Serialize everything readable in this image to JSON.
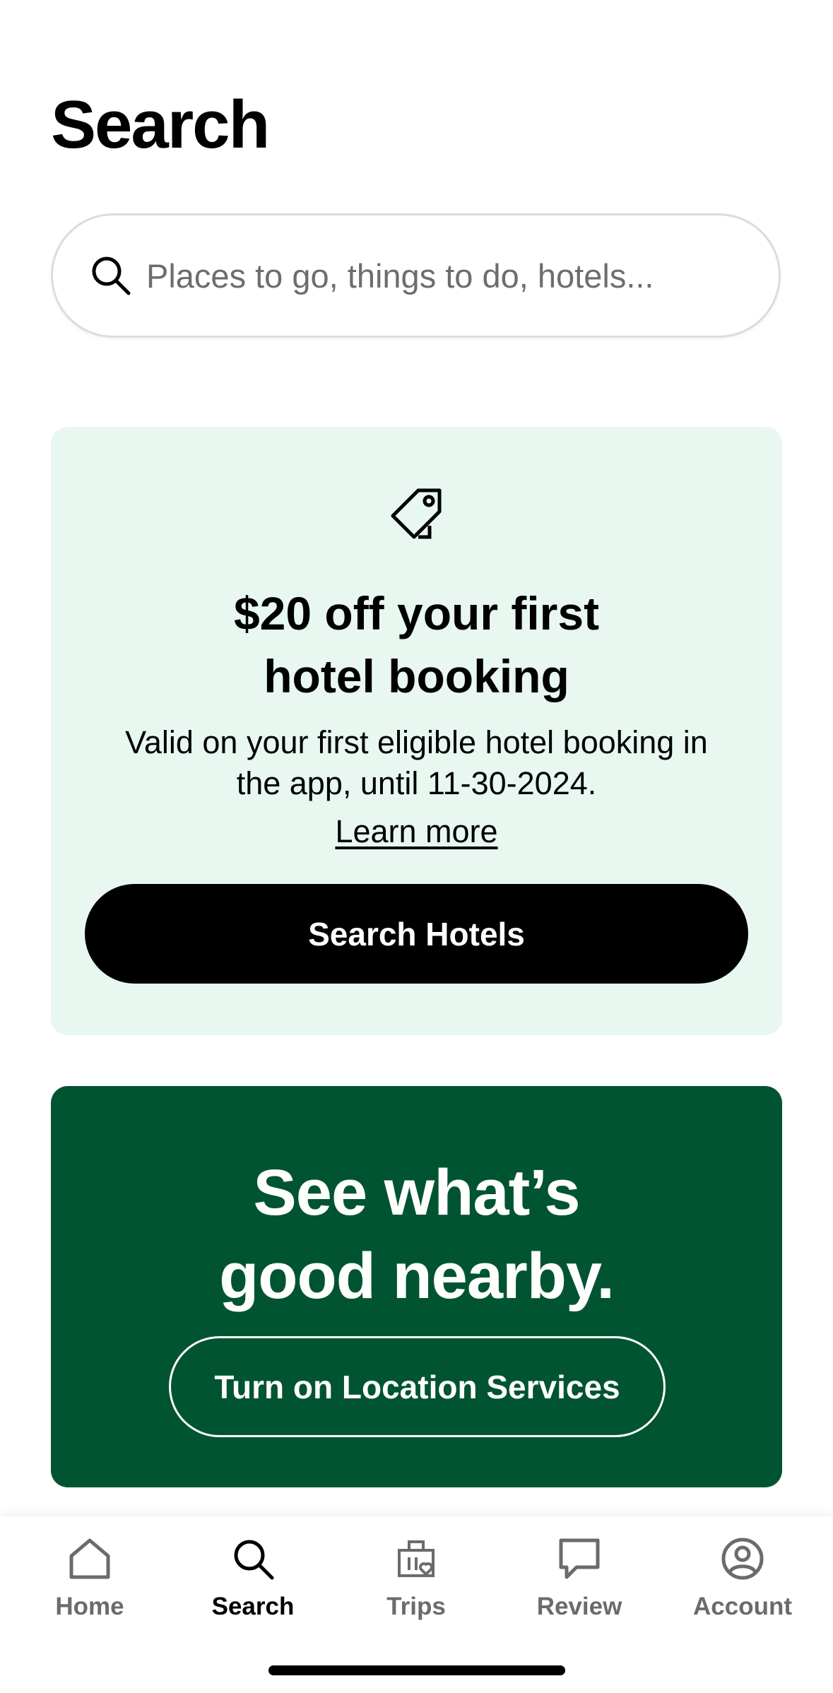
{
  "header": {
    "title": "Search"
  },
  "search": {
    "placeholder": "Places to go, things to do, hotels..."
  },
  "promo": {
    "title_line1": "$20 off your first",
    "title_line2": "hotel booking",
    "desc_line1": "Valid on your first eligible hotel booking in",
    "desc_line2": "the app, until 11-30-2024.",
    "learn_more": "Learn more",
    "button_label": "Search Hotels",
    "background_color": "#e8f8f1",
    "icon": "tag-icon"
  },
  "nearby": {
    "title_line1": "See what’s",
    "title_line2": "good nearby.",
    "button_label": "Turn on Location Services",
    "background_color": "#005431"
  },
  "tab_bar": {
    "items": [
      {
        "label": "Home",
        "icon": "home-icon",
        "active": false
      },
      {
        "label": "Search",
        "icon": "search-icon",
        "active": true
      },
      {
        "label": "Trips",
        "icon": "trips-icon",
        "active": false
      },
      {
        "label": "Review",
        "icon": "review-icon",
        "active": false
      },
      {
        "label": "Account",
        "icon": "account-icon",
        "active": false
      }
    ]
  }
}
